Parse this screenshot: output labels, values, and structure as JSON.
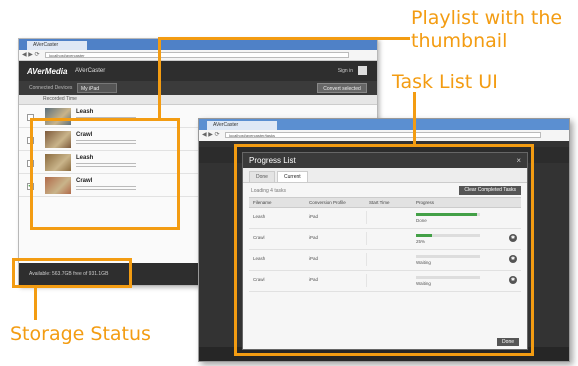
{
  "annotations": {
    "playlist": "Playlist with the\nthumbnail",
    "playlist_line1": "Playlist with the",
    "playlist_line2": "thumbnail",
    "tasklist": "Task List UI",
    "storage": "Storage Status",
    "color": "#f39c12"
  },
  "back_window": {
    "tab_label": "AVerCaster",
    "url": "localhost/avercaster",
    "logo": "AVerMedia",
    "app_name": "AVerCaster",
    "sign_in": "Sign in",
    "device_label": "Connected Devices",
    "device_select": "My iPad",
    "convert_button": "Convert selected",
    "list_header": "Recorded Time",
    "playlist": [
      {
        "title": "Leash",
        "checked": false,
        "thumb_color": "#5b6f7c"
      },
      {
        "title": "Crawl",
        "checked": false,
        "thumb_color": "#7d5a3c"
      },
      {
        "title": "Leash",
        "checked": false,
        "thumb_color": "#8a6a3e"
      },
      {
        "title": "Crawl",
        "checked": true,
        "thumb_color": "#b06a4a"
      }
    ],
    "storage_text": "Available: 563.7GB free of 931.1GB"
  },
  "front_window": {
    "tab_label": "AVerCaster",
    "url": "localhost/avercaster/tasks",
    "dialog": {
      "title": "Progress List",
      "close": "×",
      "tabs": [
        "Done",
        "Current"
      ],
      "active_tab": 1,
      "loading": "Loading 4 tasks",
      "clear_button": "Clear Completed Tasks",
      "columns": [
        "Filename",
        "Conversion Profile",
        "Start Time",
        "Progress"
      ],
      "rows": [
        {
          "filename": "Leash",
          "profile": "iPad",
          "start": "",
          "progress": 0.95,
          "status": "Done"
        },
        {
          "filename": "Crawl",
          "profile": "iPad",
          "start": "",
          "progress": 0.25,
          "status": "25%"
        },
        {
          "filename": "Leash",
          "profile": "iPad",
          "start": "",
          "progress": 0.0,
          "status": "Waiting"
        },
        {
          "filename": "Crawl",
          "profile": "iPad",
          "start": "",
          "progress": 0.0,
          "status": "Waiting"
        }
      ],
      "done_button": "Done"
    }
  }
}
